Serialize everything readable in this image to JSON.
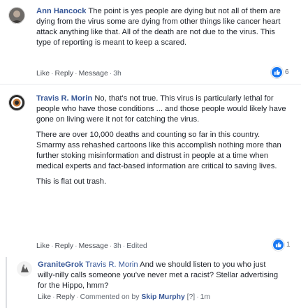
{
  "comments": [
    {
      "author": "Ann Hancock",
      "paragraphs": [
        "The point is yes people are dying but not all of them are dying from the virus some are dying from other things like cancer heart attack anything like that. All of the death are not due to the virus. This type of reporting is meant to keep a scared."
      ],
      "actions": {
        "like": "Like",
        "reply": "Reply",
        "message": "Message",
        "time": "3h"
      },
      "reactions": "6"
    },
    {
      "author": "Travis R. Morin",
      "paragraphs": [
        "No, that's not true. This virus is particularly lethal for people who have those conditions ... and those people would likely have gone on living were it not for catching the virus.",
        "There are over 10,000 deaths and counting so far in this country. Smarmy ass rehashed cartoons like this accomplish nothing more than further stoking misinformation and distrust in people at a time when medical experts and fact-based information are critical to saving lives.",
        "This is flat out trash."
      ],
      "actions": {
        "like": "Like",
        "reply": "Reply",
        "message": "Message",
        "time": "3h",
        "edited": "Edited"
      },
      "reactions": "1"
    }
  ],
  "reply": {
    "author": "GraniteGrok",
    "mention": "Travis R. Morin",
    "text": "And we should listen to you who just willy-nilly calls someone you've never met a racist? Stellar advertising for the Hippo, hmm?",
    "actions": {
      "like": "Like",
      "reply": "Reply",
      "commented_prefix": "Commented on by",
      "commented_by": "Skip Murphy",
      "help_marker": "[?]",
      "time": "1m"
    }
  }
}
